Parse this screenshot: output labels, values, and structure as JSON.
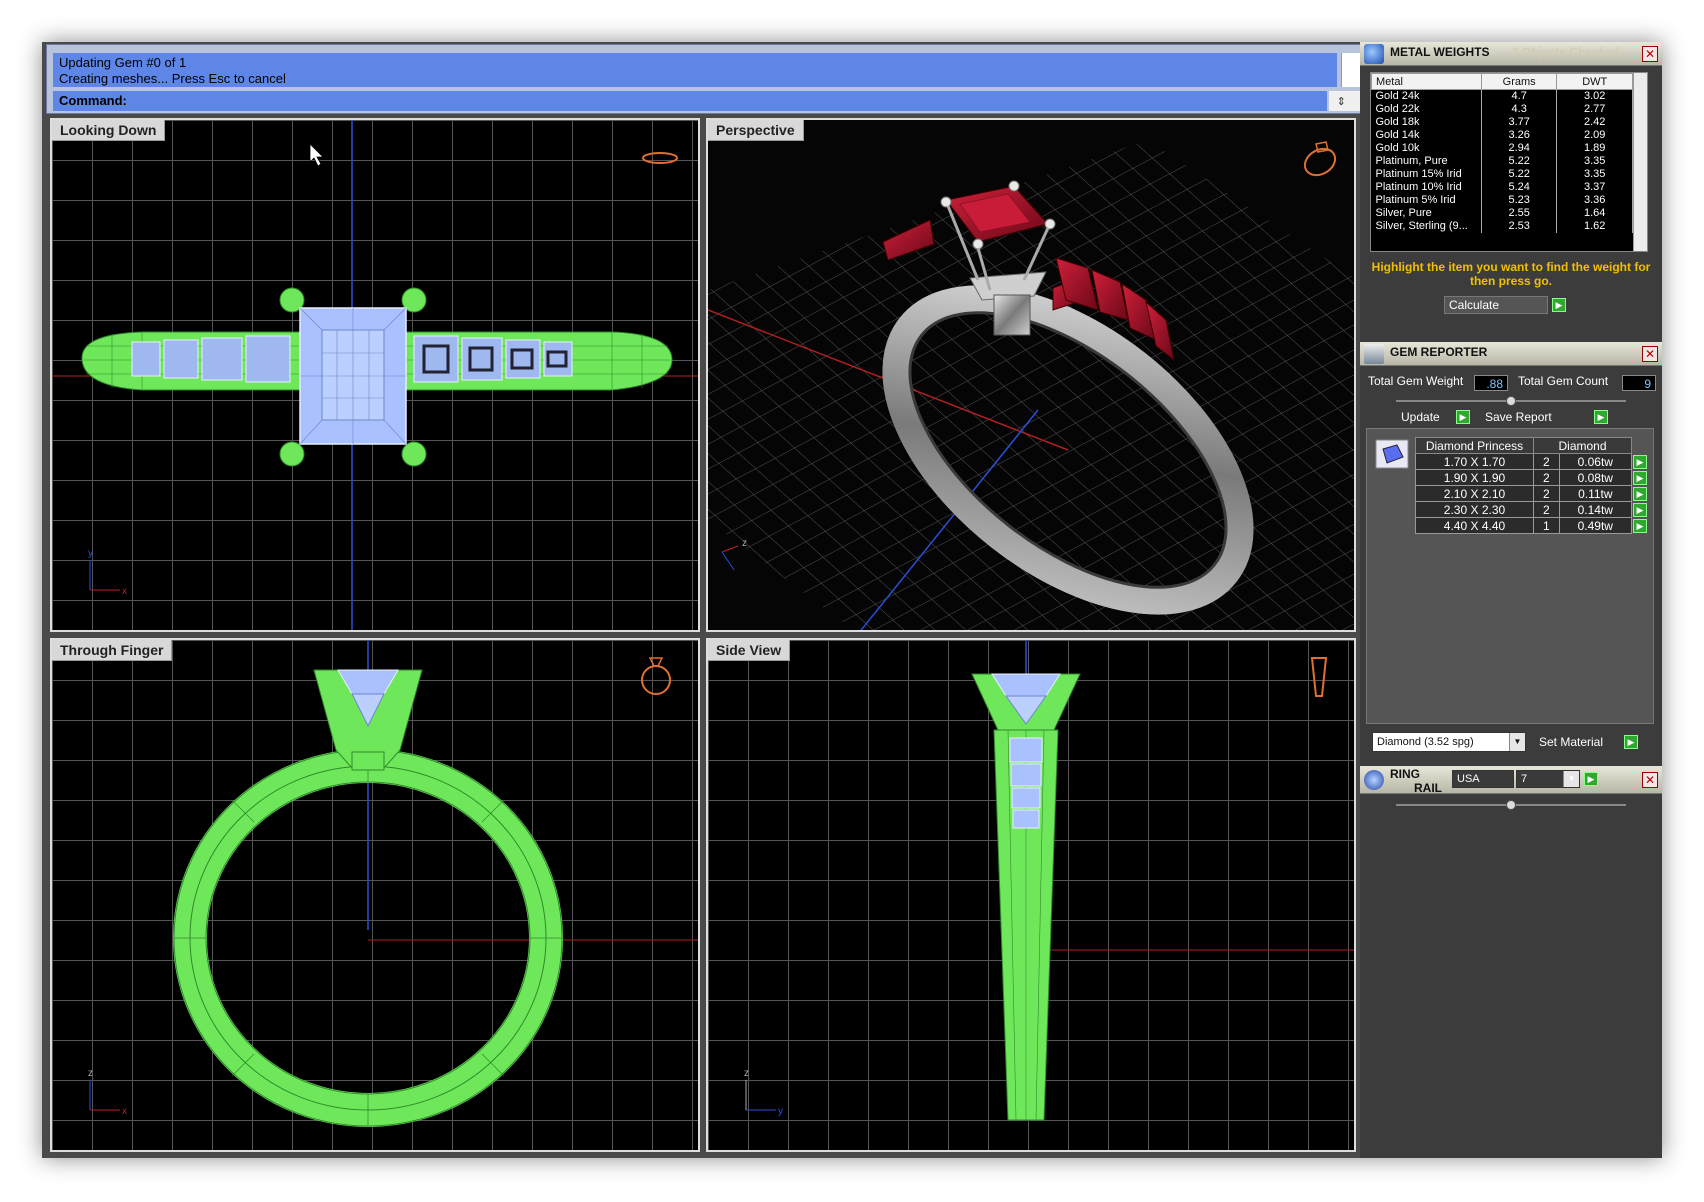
{
  "command": {
    "history_line1": "Updating Gem #0 of 1",
    "history_line2": "Creating meshes... Press Esc to cancel",
    "prompt_label": "Command:",
    "prompt_value": ""
  },
  "viewports": {
    "top_left": "Looking Down",
    "top_right": "Perspective",
    "bottom_left": "Through Finger",
    "bottom_right": "Side View",
    "axis_x": "x",
    "axis_y": "y",
    "axis_z": "z"
  },
  "metal_weights": {
    "title": "METAL WEIGHTS",
    "subtitle": "3 Objects Checked",
    "headers": [
      "Metal",
      "Grams",
      "DWT"
    ],
    "rows": [
      [
        "Gold 24k",
        "4.7",
        "3.02"
      ],
      [
        "Gold 22k",
        "4.3",
        "2.77"
      ],
      [
        "Gold 18k",
        "3.77",
        "2.42"
      ],
      [
        "Gold 14k",
        "3.26",
        "2.09"
      ],
      [
        "Gold 10k",
        "2.94",
        "1.89"
      ],
      [
        "Platinum, Pure",
        "5.22",
        "3.35"
      ],
      [
        "Platinum 15% Irid",
        "5.22",
        "3.35"
      ],
      [
        "Platinum 10% Irid",
        "5.24",
        "3.37"
      ],
      [
        "Platinum 5% Irid",
        "5.23",
        "3.36"
      ],
      [
        "Silver, Pure",
        "2.55",
        "1.64"
      ],
      [
        "Silver, Sterling (9...",
        "2.53",
        "1.62"
      ]
    ],
    "hint": "Highlight the item you want to find the weight for then press go.",
    "calculate_label": "Calculate"
  },
  "gem_reporter": {
    "title": "GEM REPORTER",
    "total_weight_label": "Total Gem Weight",
    "total_weight_value": ".88",
    "total_count_label": "Total Gem Count",
    "total_count_value": "9",
    "update_label": "Update",
    "save_report_label": "Save Report",
    "table_headers": [
      "Diamond Princess",
      "Diamond"
    ],
    "rows": [
      [
        "1.70 X 1.70",
        "2",
        "0.06tw"
      ],
      [
        "1.90 X 1.90",
        "2",
        "0.08tw"
      ],
      [
        "2.10 X 2.10",
        "2",
        "0.11tw"
      ],
      [
        "2.30 X 2.30",
        "2",
        "0.14tw"
      ],
      [
        "4.40 X 4.40",
        "1",
        "0.49tw"
      ]
    ],
    "material_select": "Diamond    (3.52 spg)",
    "set_material_label": "Set Material"
  },
  "ring_rail": {
    "title_line1": "RING",
    "title_line2": "RAIL",
    "country": "USA",
    "size": "7"
  },
  "colors": {
    "wire_green": "#7aee5a",
    "gem_blue": "#a9c1ff",
    "ruby": "#a0102a",
    "command_blue": "#5d86e6",
    "hint_yellow": "#f0c000"
  }
}
